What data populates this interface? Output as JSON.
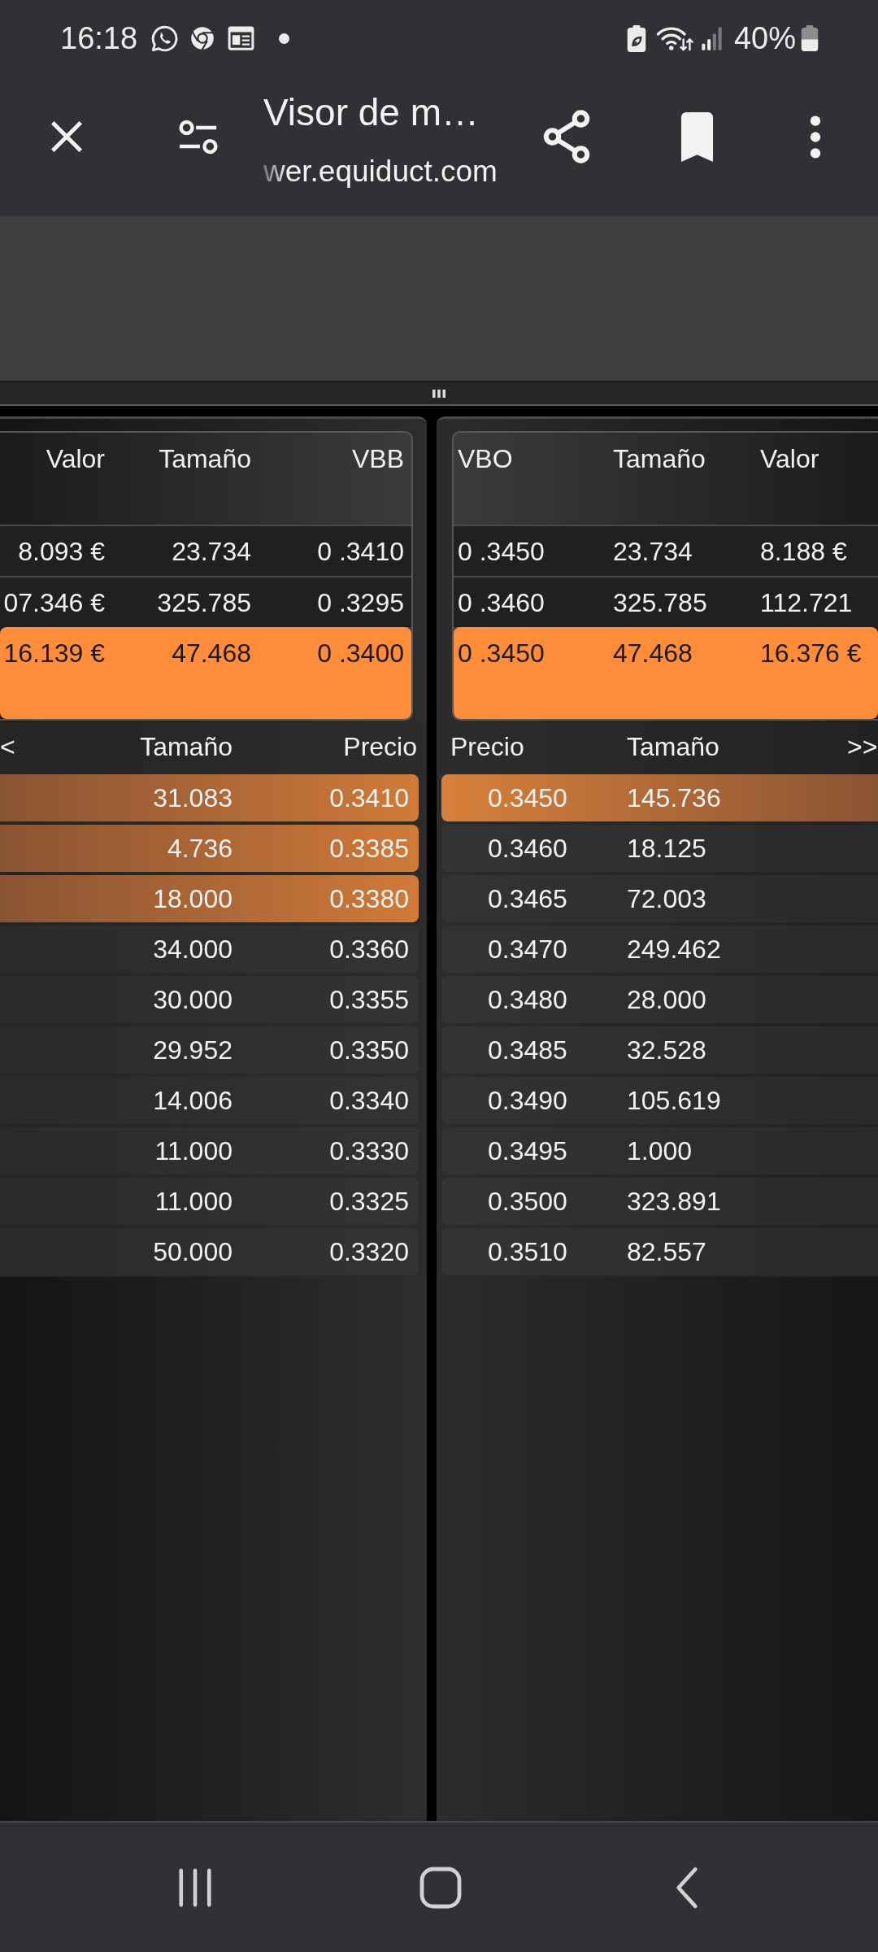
{
  "status_bar": {
    "time": "16:18",
    "battery": "40%"
  },
  "toolbar": {
    "title": "Visor de m…",
    "url": "wer.equiduct.com"
  },
  "bid_summary": {
    "columns": [
      "Valor",
      "Tamaño",
      "VBB"
    ],
    "rows": [
      {
        "cells": [
          "8.093 €",
          "23.734",
          "0 .3410"
        ],
        "highlighted": false
      },
      {
        "cells": [
          "07.346 €",
          "325.785",
          "0 .3295"
        ],
        "highlighted": false
      },
      {
        "cells": [
          "16.139 €",
          "47.468",
          "0 .3400"
        ],
        "highlighted": true
      }
    ]
  },
  "ask_summary": {
    "columns": [
      "VBO",
      "Tamaño",
      "Valor"
    ],
    "rows": [
      {
        "cells": [
          "0 .3450",
          "23.734",
          "8.188 €"
        ],
        "highlighted": false
      },
      {
        "cells": [
          "0 .3460",
          "325.785",
          "112.721"
        ],
        "highlighted": false
      },
      {
        "cells": [
          "0 .3450",
          "47.468",
          "16.376 €"
        ],
        "highlighted": true
      }
    ]
  },
  "bid_book": {
    "arrow": "<",
    "columns": [
      "Tamaño",
      "Precio"
    ],
    "rows": [
      {
        "size": "31.083",
        "price": "0.3410",
        "highlighted": true
      },
      {
        "size": "4.736",
        "price": "0.3385",
        "highlighted": true
      },
      {
        "size": "18.000",
        "price": "0.3380",
        "highlighted": true
      },
      {
        "size": "34.000",
        "price": "0.3360",
        "highlighted": false
      },
      {
        "size": "30.000",
        "price": "0.3355",
        "highlighted": false
      },
      {
        "size": "29.952",
        "price": "0.3350",
        "highlighted": false
      },
      {
        "size": "14.006",
        "price": "0.3340",
        "highlighted": false
      },
      {
        "size": "11.000",
        "price": "0.3330",
        "highlighted": false
      },
      {
        "size": "11.000",
        "price": "0.3325",
        "highlighted": false
      },
      {
        "size": "50.000",
        "price": "0.3320",
        "highlighted": false
      }
    ]
  },
  "ask_book": {
    "columns": [
      "Precio",
      "Tamaño"
    ],
    "arrow": ">>",
    "rows": [
      {
        "price": "0.3450",
        "size": "145.736",
        "highlighted": true
      },
      {
        "price": "0.3460",
        "size": "18.125",
        "highlighted": false
      },
      {
        "price": "0.3465",
        "size": "72.003",
        "highlighted": false
      },
      {
        "price": "0.3470",
        "size": "249.462",
        "highlighted": false
      },
      {
        "price": "0.3480",
        "size": "28.000",
        "highlighted": false
      },
      {
        "price": "0.3485",
        "size": "32.528",
        "highlighted": false
      },
      {
        "price": "0.3490",
        "size": "105.619",
        "highlighted": false
      },
      {
        "price": "0.3495",
        "size": "1.000",
        "highlighted": false
      },
      {
        "price": "0.3500",
        "size": "323.891",
        "highlighted": false
      },
      {
        "price": "0.3510",
        "size": "82.557",
        "highlighted": false
      }
    ]
  }
}
